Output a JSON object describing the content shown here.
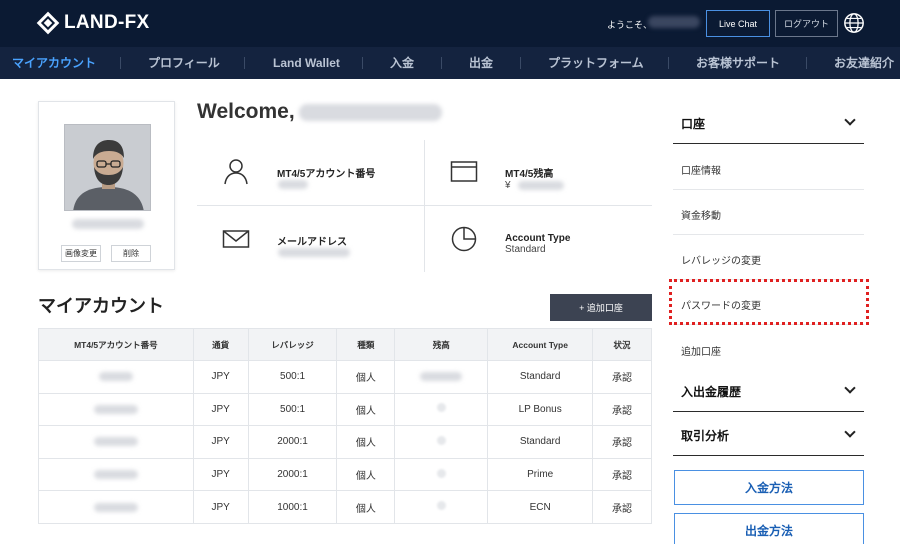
{
  "header": {
    "logo_text": "LAND-FX",
    "welcome_prefix": "ようこそ、",
    "live_chat_label": "Live Chat",
    "logout_label": "ログアウト",
    "globe_icon": "globe-icon"
  },
  "nav": {
    "items": [
      {
        "label": "マイアカウント",
        "active": true
      },
      {
        "label": "プロフィール",
        "active": false
      },
      {
        "label": "Land Wallet",
        "active": false
      },
      {
        "label": "入金",
        "active": false
      },
      {
        "label": "出金",
        "active": false
      },
      {
        "label": "プラットフォーム",
        "active": false
      },
      {
        "label": "お客様サポート",
        "active": false
      },
      {
        "label": "お友達紹介",
        "active": false
      }
    ]
  },
  "profile": {
    "change_image_label": "画像変更",
    "delete_label": "削除"
  },
  "welcome": {
    "title": "Welcome,"
  },
  "info": {
    "account_number_label": "MT4/5アカウント番号",
    "balance_label": "MT4/5残高",
    "balance_currency": "¥",
    "email_label": "メールアドレス",
    "account_type_label": "Account Type",
    "account_type_value": "Standard"
  },
  "my_account": {
    "title": "マイアカウント",
    "add_account_label": "+ 追加口座",
    "columns": [
      "MT4/5アカウント番号",
      "通貨",
      "レバレッジ",
      "種類",
      "残高",
      "Account Type",
      "状況"
    ],
    "rows": [
      {
        "currency": "JPY",
        "leverage": "500:1",
        "kind": "個人",
        "account_type": "Standard",
        "status": "承認"
      },
      {
        "currency": "JPY",
        "leverage": "500:1",
        "kind": "個人",
        "account_type": "LP Bonus",
        "status": "承認"
      },
      {
        "currency": "JPY",
        "leverage": "2000:1",
        "kind": "個人",
        "account_type": "Standard",
        "status": "承認"
      },
      {
        "currency": "JPY",
        "leverage": "2000:1",
        "kind": "個人",
        "account_type": "Prime",
        "status": "承認"
      },
      {
        "currency": "JPY",
        "leverage": "1000:1",
        "kind": "個人",
        "account_type": "ECN",
        "status": "承認"
      }
    ]
  },
  "sidebar": {
    "account_header": "口座",
    "items": [
      "口座情報",
      "資金移動",
      "レバレッジの変更",
      "パスワードの変更",
      "追加口座"
    ],
    "history_header": "入出金履歴",
    "analysis_header": "取引分析",
    "deposit_method_label": "入金方法",
    "withdraw_method_label": "出金方法"
  },
  "colors": {
    "header_bg": "#0b1a33",
    "nav_bg": "#14233f",
    "nav_active": "#4aa3ff",
    "link": "#1a73e8",
    "highlight": "#e02020"
  }
}
